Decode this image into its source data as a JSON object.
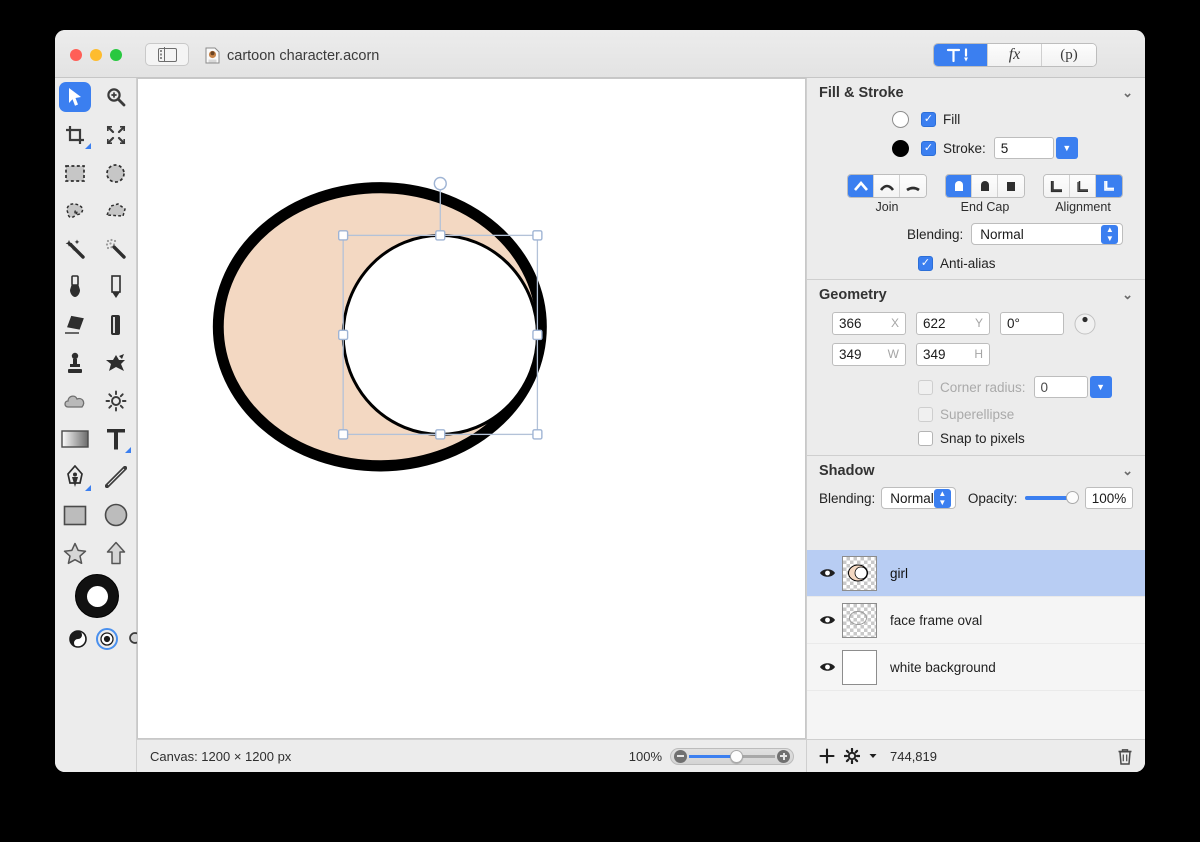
{
  "window": {
    "document_title": "cartoon character.acorn",
    "doc_icon": "acorn-document-icon",
    "sidebar_toggle_icon": "sidebar-panel-icon",
    "traffic_lights": [
      "close-button",
      "minimize-button",
      "maximize-button"
    ]
  },
  "toolbar_segments": [
    {
      "name": "tools-segment",
      "label": "",
      "icon": "hammer-pen-icon",
      "active": true
    },
    {
      "name": "effects-segment",
      "label": "fx",
      "icon": "fx-icon",
      "active": false
    },
    {
      "name": "palette-segment",
      "label": "(p)",
      "icon": "p-icon",
      "active": false
    }
  ],
  "tools": [
    {
      "name": "move-tool",
      "icon": "cursor-arrow-icon",
      "selected": true,
      "badge": false
    },
    {
      "name": "zoom-tool",
      "icon": "magnifier-plus-icon",
      "selected": false,
      "badge": false
    },
    {
      "name": "crop-tool",
      "icon": "crop-icon",
      "selected": false,
      "badge": true
    },
    {
      "name": "resize-tool",
      "icon": "arrows-expand-icon",
      "selected": false,
      "badge": false
    },
    {
      "name": "rectangular-selection-tool",
      "icon": "dashed-rectangle-icon",
      "selected": false,
      "badge": false
    },
    {
      "name": "elliptical-selection-tool",
      "icon": "dashed-ellipse-icon",
      "selected": false,
      "badge": false
    },
    {
      "name": "lasso-tool",
      "icon": "lasso-icon",
      "selected": false,
      "badge": false
    },
    {
      "name": "polygon-lasso-tool",
      "icon": "polygon-lasso-icon",
      "selected": false,
      "badge": false
    },
    {
      "name": "magic-wand-tool",
      "icon": "magic-wand-icon",
      "selected": false,
      "badge": false
    },
    {
      "name": "instant-alpha-tool",
      "icon": "instant-alpha-wand-icon",
      "selected": false,
      "badge": false
    },
    {
      "name": "brush-tool",
      "icon": "paint-brush-icon",
      "selected": false,
      "badge": false
    },
    {
      "name": "pencil-tool",
      "icon": "pencil-icon",
      "selected": false,
      "badge": false
    },
    {
      "name": "paint-bucket-tool",
      "icon": "paint-bucket-icon",
      "selected": false,
      "badge": false
    },
    {
      "name": "eraser-tool",
      "icon": "eraser-icon",
      "selected": false,
      "badge": false
    },
    {
      "name": "clone-stamp-tool",
      "icon": "clone-stamp-icon",
      "selected": false,
      "badge": false
    },
    {
      "name": "smudge-tool",
      "icon": "smudge-splat-icon",
      "selected": false,
      "badge": false
    },
    {
      "name": "blur-tool",
      "icon": "cloud-blur-icon",
      "selected": false,
      "badge": false
    },
    {
      "name": "dodge-tool",
      "icon": "sun-dodge-icon",
      "selected": false,
      "badge": false
    },
    {
      "name": "gradient-tool",
      "icon": "gradient-icon",
      "selected": false,
      "badge": false
    },
    {
      "name": "text-tool",
      "icon": "text-t-icon",
      "selected": false,
      "badge": true
    },
    {
      "name": "pen-tool",
      "icon": "pen-nib-icon",
      "selected": false,
      "badge": true
    },
    {
      "name": "line-tool",
      "icon": "line-icon",
      "selected": false,
      "badge": false
    },
    {
      "name": "rectangle-shape-tool",
      "icon": "rectangle-icon",
      "selected": false,
      "badge": false
    },
    {
      "name": "ellipse-shape-tool",
      "icon": "ellipse-icon",
      "selected": false,
      "badge": false
    },
    {
      "name": "star-shape-tool",
      "icon": "star-icon",
      "selected": false,
      "badge": false
    },
    {
      "name": "arrow-shape-tool",
      "icon": "arrow-up-icon",
      "selected": false,
      "badge": false
    }
  ],
  "color_controls": {
    "swatch_icon": "foreground-background-color-swatch",
    "swatch_outer_color": "#111111",
    "swatch_inner_color": "#ffffff",
    "mini": [
      {
        "name": "swap-colors-control",
        "icon": "half-filled-circle-icon",
        "selected": false
      },
      {
        "name": "color-mode-control",
        "icon": "dot-in-circle-icon",
        "selected": true
      },
      {
        "name": "color-picker-control",
        "icon": "magnifier-icon",
        "selected": false
      }
    ]
  },
  "canvas": {
    "artwork": {
      "outer_ellipse": {
        "fill": "#f3d8c2",
        "stroke": "#000000",
        "stroke_width": 11
      },
      "inner_circle": {
        "fill": "#ffffff",
        "stroke": "#000000",
        "stroke_width": 3
      }
    },
    "selection": {
      "handle_count": 8,
      "rotation_handle": true,
      "handle_fill": "#ffffff",
      "handle_border": "#9fb4d4",
      "box_line_color": "#b3c2d8"
    }
  },
  "status_bar": {
    "canvas_label": "Canvas: 1200 × 1200 px",
    "zoom_level": "100%",
    "zoom_out_icon": "zoom-out-icon",
    "zoom_in_icon": "zoom-in-icon"
  },
  "inspector": {
    "fill_stroke": {
      "title": "Fill & Stroke",
      "collapse_icon": "chevron-down-icon",
      "fill": {
        "label": "Fill",
        "checked": true,
        "swatch_color": "#ffffff"
      },
      "stroke": {
        "label": "Stroke:",
        "checked": true,
        "swatch_color": "#000000",
        "width_value": "5"
      },
      "join": {
        "label": "Join",
        "options": [
          {
            "name": "join-miter",
            "icon": "miter-join-icon",
            "selected": true
          },
          {
            "name": "join-round",
            "icon": "round-join-icon",
            "selected": false
          },
          {
            "name": "join-bevel",
            "icon": "bevel-join-icon",
            "selected": false
          }
        ]
      },
      "end_cap": {
        "label": "End Cap",
        "options": [
          {
            "name": "cap-round",
            "icon": "round-cap-icon",
            "selected": true
          },
          {
            "name": "cap-butt",
            "icon": "butt-cap-icon",
            "selected": false
          },
          {
            "name": "cap-square",
            "icon": "square-cap-icon",
            "selected": false
          }
        ]
      },
      "alignment": {
        "label": "Alignment",
        "options": [
          {
            "name": "align-inside",
            "icon": "align-inside-icon",
            "selected": false
          },
          {
            "name": "align-center",
            "icon": "align-center-icon",
            "selected": false
          },
          {
            "name": "align-outside",
            "icon": "align-outside-icon",
            "selected": true
          }
        ]
      },
      "blending": {
        "label": "Blending:",
        "value": "Normal"
      },
      "anti_alias": {
        "label": "Anti-alias",
        "checked": true
      }
    },
    "geometry": {
      "title": "Geometry",
      "collapse_icon": "chevron-down-icon",
      "x": {
        "value": "366",
        "tag": "X"
      },
      "y": {
        "value": "622",
        "tag": "Y"
      },
      "rotation": {
        "value": "0°"
      },
      "rotation_dial_icon": "rotation-dial-icon",
      "w": {
        "value": "349",
        "tag": "W"
      },
      "h": {
        "value": "349",
        "tag": "H"
      },
      "corner_radius": {
        "label": "Corner radius:",
        "checked": false,
        "enabled": false,
        "value": "0"
      },
      "superellipse": {
        "label": "Superellipse",
        "checked": false,
        "enabled": false
      },
      "snap_to_pixels": {
        "label": "Snap to pixels",
        "checked": false,
        "enabled": true
      }
    },
    "shadow": {
      "title": "Shadow",
      "collapse_icon": "chevron-down-icon",
      "blending": {
        "label": "Blending:",
        "value": "Normal"
      },
      "opacity": {
        "label": "Opacity:",
        "value": "100%",
        "percent": 100
      }
    },
    "layers": [
      {
        "name": "girl",
        "selected": true,
        "visible": true,
        "thumb": "checker-peach-crescent"
      },
      {
        "name": "face frame oval",
        "selected": false,
        "visible": true,
        "thumb": "checker-ellipse-outline"
      },
      {
        "name": "white background",
        "selected": false,
        "visible": true,
        "thumb": "solid-white"
      }
    ],
    "layer_bar": {
      "add_icon": "plus-icon",
      "settings_icon": "gear-dropdown-icon",
      "memory_value": "744,819",
      "delete_icon": "trash-icon"
    }
  }
}
